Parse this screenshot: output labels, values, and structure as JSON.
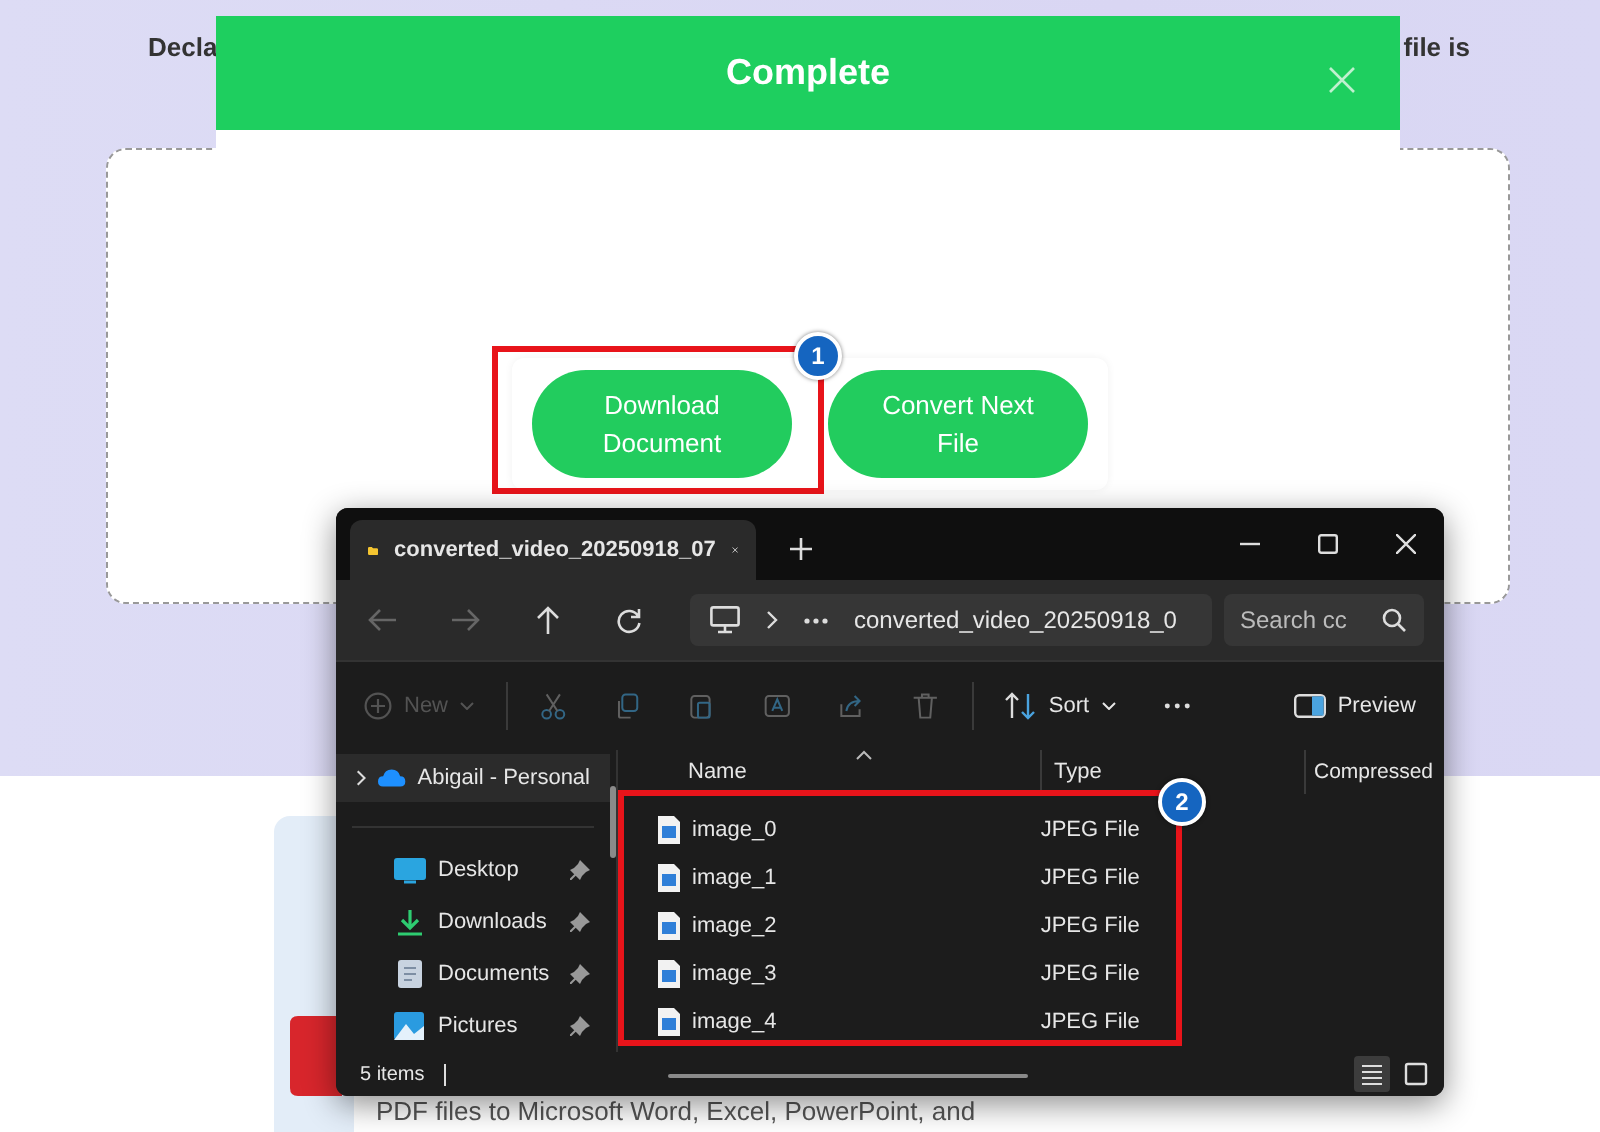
{
  "background": {
    "intro_left": "Decla",
    "intro_right": "file is",
    "footer_text": "PDF files to Microsoft Word, Excel, PowerPoint, and"
  },
  "dialog": {
    "title": "Complete",
    "buttons": [
      {
        "label": "Download Document",
        "highlighted": true,
        "callout": "1"
      },
      {
        "label": "Convert Next File",
        "highlighted": false
      }
    ]
  },
  "explorer": {
    "tabs": [
      {
        "label": "converted_video_20250918_07",
        "selected": true
      }
    ],
    "address": "converted_video_20250918_0",
    "search": {
      "placeholder": "Search cc"
    },
    "toolbar": [
      {
        "kind": "new",
        "label": "New",
        "disabled": true
      },
      {
        "kind": "cut",
        "disabled": true
      },
      {
        "kind": "copy",
        "disabled": true
      },
      {
        "kind": "paste",
        "disabled": true
      },
      {
        "kind": "rename",
        "disabled": true
      },
      {
        "kind": "share",
        "disabled": true
      },
      {
        "kind": "delete",
        "disabled": true
      },
      {
        "kind": "sort",
        "label": "Sort",
        "disabled": false
      },
      {
        "kind": "more",
        "disabled": false
      },
      {
        "kind": "preview",
        "label": "Preview",
        "disabled": false
      }
    ],
    "sidebar": [
      {
        "kind": "cloud",
        "label": "Abigail - Personal",
        "selected": true
      },
      {
        "kind": "desktop",
        "label": "Desktop",
        "selected": false
      },
      {
        "kind": "downloads",
        "label": "Downloads",
        "selected": false
      },
      {
        "kind": "documents",
        "label": "Documents",
        "selected": false
      },
      {
        "kind": "pictures",
        "label": "Pictures",
        "selected": false
      }
    ],
    "columns": [
      "Name",
      "Type",
      "Compressed"
    ],
    "rows": [
      {
        "name": "image_0",
        "type": "JPEG File"
      },
      {
        "name": "image_1",
        "type": "JPEG File"
      },
      {
        "name": "image_2",
        "type": "JPEG File"
      },
      {
        "name": "image_3",
        "type": "JPEG File"
      },
      {
        "name": "image_4",
        "type": "JPEG File"
      }
    ],
    "rows_callout": "2",
    "status": "5 items",
    "views": [
      {
        "kind": "details",
        "selected": true
      },
      {
        "kind": "tiles",
        "selected": false
      }
    ]
  }
}
